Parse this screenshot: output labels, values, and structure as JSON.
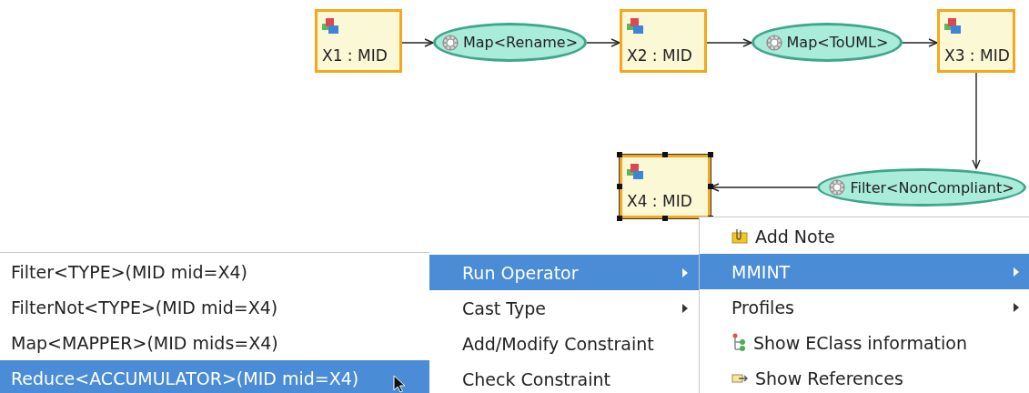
{
  "diagram": {
    "nodes": [
      {
        "kind": "model",
        "label": "X1 : MID",
        "selected": false
      },
      {
        "kind": "operator",
        "label": "Map<Rename>",
        "selected": false
      },
      {
        "kind": "model",
        "label": "X2 : MID",
        "selected": false
      },
      {
        "kind": "operator",
        "label": "Map<ToUML>",
        "selected": false
      },
      {
        "kind": "model",
        "label": "X3 : MID",
        "selected": false
      },
      {
        "kind": "operator",
        "label": "Filter<NonCompliant>",
        "selected": false
      },
      {
        "kind": "model",
        "label": "X4 : MID",
        "selected": true
      }
    ]
  },
  "menus": [
    {
      "items": [
        {
          "kind": "plain",
          "label": "Filter<TYPE>(MID mid=X4)",
          "submenu": false,
          "selected": false
        },
        {
          "kind": "plain",
          "label": "FilterNot<TYPE>(MID mid=X4)",
          "submenu": false,
          "selected": false
        },
        {
          "kind": "plain",
          "label": "Map<MAPPER>(MID mids=X4)",
          "submenu": false,
          "selected": false
        },
        {
          "kind": "plain",
          "label": "Reduce<ACCUMULATOR>(MID mid=X4)",
          "submenu": false,
          "selected": true
        }
      ]
    },
    {
      "items": [
        {
          "kind": "plain",
          "label": "Run Operator",
          "submenu": true,
          "selected": true
        },
        {
          "kind": "plain",
          "label": "Cast Type",
          "submenu": true,
          "selected": false
        },
        {
          "kind": "plain",
          "label": "Add/Modify Constraint",
          "submenu": false,
          "selected": false
        },
        {
          "kind": "plain",
          "label": "Check Constraint",
          "submenu": false,
          "selected": false
        }
      ]
    },
    {
      "items": [
        {
          "kind": "note",
          "label": "Add Note",
          "submenu": false,
          "selected": false
        },
        {
          "kind": "plain",
          "label": "MMINT",
          "submenu": true,
          "selected": true
        },
        {
          "kind": "plain",
          "label": "Profiles",
          "submenu": true,
          "selected": false
        },
        {
          "kind": "tree",
          "label": "Show EClass information",
          "submenu": false,
          "selected": false
        },
        {
          "kind": "references",
          "label": "Show References",
          "submenu": false,
          "selected": false
        }
      ]
    }
  ]
}
